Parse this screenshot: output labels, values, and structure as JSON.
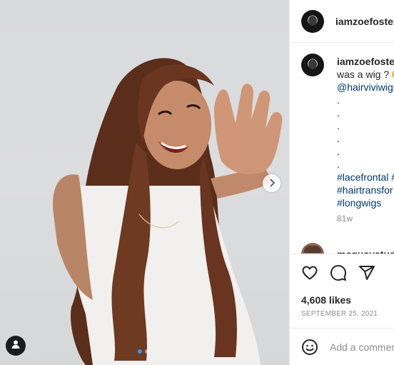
{
  "post": {
    "username": "iamzoefoster",
    "likes": "4,608 likes",
    "date": "SEPTEMBER 25, 2021",
    "carousel": {
      "count": 2,
      "active_index": 0
    }
  },
  "caption": {
    "username": "iamzoefoster",
    "text_line": "was a wig ?",
    "mention": "@hairviviwigs",
    "dot_lines": [
      ".",
      ".",
      ".",
      ".",
      ".",
      "."
    ],
    "hashtags": [
      "#lacefrontal #",
      "#hairtransfor",
      "#longwigs"
    ],
    "time": "81w"
  },
  "comment": {
    "username": "mcquaystudi"
  },
  "add_comment": {
    "placeholder": "Add a commen"
  },
  "icons": {
    "like": "heart-icon",
    "comment": "comment-icon",
    "share": "paper-plane-icon",
    "next": "chevron-right-icon",
    "tag": "user-tag-icon",
    "emoji": "emoji-icon"
  },
  "colors": {
    "link": "#00376b",
    "active_dot": "#3897f0",
    "muted": "#8e8e8e"
  }
}
